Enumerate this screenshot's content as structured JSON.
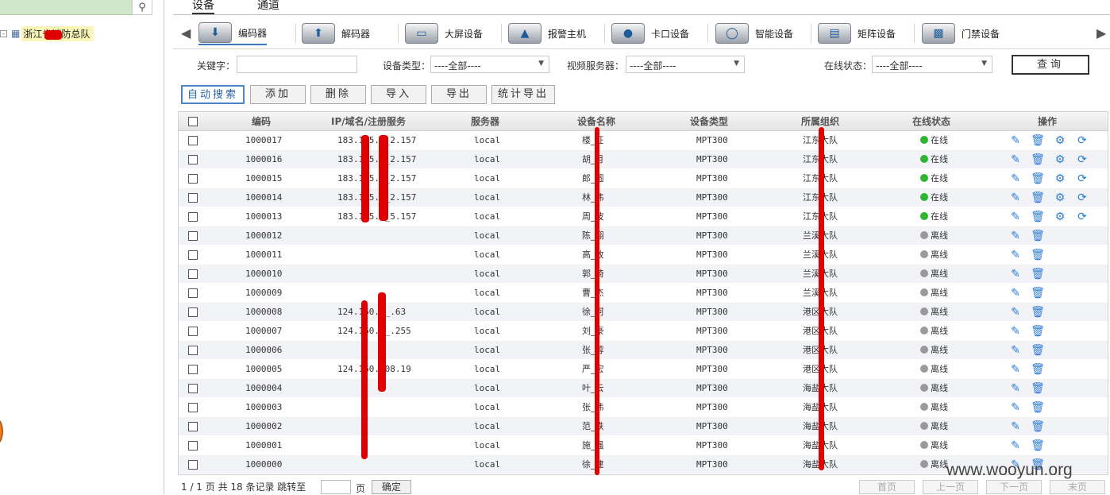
{
  "left": {
    "tree_root_label": "浙江省消防总队",
    "tree_toggle": "-"
  },
  "top_tabs": [
    "设备",
    "通道"
  ],
  "categories": [
    {
      "label": "编码器",
      "icon": "encoder-icon"
    },
    {
      "label": "解码器",
      "icon": "decoder-icon"
    },
    {
      "label": "大屏设备",
      "icon": "screen-icon"
    },
    {
      "label": "报警主机",
      "icon": "alarm-icon"
    },
    {
      "label": "卡口设备",
      "icon": "checkpoint-icon"
    },
    {
      "label": "智能设备",
      "icon": "smart-icon"
    },
    {
      "label": "矩阵设备",
      "icon": "matrix-icon"
    },
    {
      "label": "门禁设备",
      "icon": "lock-icon"
    }
  ],
  "filter": {
    "keyword_label": "关键字：",
    "type_label": "设备类型：",
    "type_value": "----全部----",
    "server_label": "视频服务器：",
    "server_value": "----全部----",
    "status_label": "在线状态：",
    "status_value": "----全部----",
    "query_label": "查询"
  },
  "toolbar": [
    "自动搜索",
    "添加",
    "删除",
    "导入",
    "导出",
    "统计导出"
  ],
  "columns": [
    "编码",
    "IP/域名/注册服务",
    "服务器",
    "设备名称",
    "设备类型",
    "所属组织",
    "在线状态",
    "操作"
  ],
  "rows": [
    {
      "code": "1000017",
      "ip": "183.1_5.1_2.157",
      "server": "local",
      "name": "楼_征",
      "type": "MPT300",
      "org": "江东大队",
      "status": "在线",
      "online": true
    },
    {
      "code": "1000016",
      "ip": "183.1_5.1_2.157",
      "server": "local",
      "name": "胡_月",
      "type": "MPT300",
      "org": "江东大队",
      "status": "在线",
      "online": true
    },
    {
      "code": "1000015",
      "ip": "183.1_5.1_2.157",
      "server": "local",
      "name": "郎_圆",
      "type": "MPT300",
      "org": "江东大队",
      "status": "在线",
      "online": true
    },
    {
      "code": "1000014",
      "ip": "183.1_5.1_2.157",
      "server": "local",
      "name": "林_伟",
      "type": "MPT300",
      "org": "江东大队",
      "status": "在线",
      "online": true
    },
    {
      "code": "1000013",
      "ip": "183.1_5.1_5.157",
      "server": "local",
      "name": "周_波",
      "type": "MPT300",
      "org": "江东大队",
      "status": "在线",
      "online": true
    },
    {
      "code": "1000012",
      "ip": "",
      "server": "local",
      "name": "陈_翔",
      "type": "MPT300",
      "org": "兰溪大队",
      "status": "离线",
      "online": false
    },
    {
      "code": "1000011",
      "ip": "",
      "server": "local",
      "name": "高_政",
      "type": "MPT300",
      "org": "兰溪大队",
      "status": "离线",
      "online": false
    },
    {
      "code": "1000010",
      "ip": "",
      "server": "local",
      "name": "郭_琦",
      "type": "MPT300",
      "org": "兰溪大队",
      "status": "离线",
      "online": false
    },
    {
      "code": "1000009",
      "ip": "",
      "server": "local",
      "name": "曹_杰",
      "type": "MPT300",
      "org": "兰溪大队",
      "status": "离线",
      "online": false
    },
    {
      "code": "1000008",
      "ip": "124.160.__.63",
      "server": "local",
      "name": "徐_珂",
      "type": "MPT300",
      "org": "港区大队",
      "status": "离线",
      "online": false
    },
    {
      "code": "1000007",
      "ip": "124.160.__.255",
      "server": "local",
      "name": "刘_豪",
      "type": "MPT300",
      "org": "港区大队",
      "status": "离线",
      "online": false
    },
    {
      "code": "1000006",
      "ip": "",
      "server": "local",
      "name": "张_蓉",
      "type": "MPT300",
      "org": "港区大队",
      "status": "离线",
      "online": false
    },
    {
      "code": "1000005",
      "ip": "124.160.208.19",
      "server": "local",
      "name": "严_宏",
      "type": "MPT300",
      "org": "港区大队",
      "status": "离线",
      "online": false
    },
    {
      "code": "1000004",
      "ip": "",
      "server": "local",
      "name": "叶_云",
      "type": "MPT300",
      "org": "海盐大队",
      "status": "离线",
      "online": false
    },
    {
      "code": "1000003",
      "ip": "",
      "server": "local",
      "name": "张_伟",
      "type": "MPT300",
      "org": "海盐大队",
      "status": "离线",
      "online": false
    },
    {
      "code": "1000002",
      "ip": "",
      "server": "local",
      "name": "范_轶",
      "type": "MPT300",
      "org": "海盐大队",
      "status": "离线",
      "online": false
    },
    {
      "code": "1000001",
      "ip": "",
      "server": "local",
      "name": "施_强",
      "type": "MPT300",
      "org": "海盐大队",
      "status": "离线",
      "online": false
    },
    {
      "code": "1000000",
      "ip": "",
      "server": "local",
      "name": "徐_建",
      "type": "MPT300",
      "org": "海盐大队",
      "status": "离线",
      "online": false
    }
  ],
  "pager": {
    "info": "1 / 1 页 共 18 条记录 跳转至",
    "page_unit": "页",
    "ok_label": "确定",
    "first": "首页",
    "prev": "上一页",
    "next": "下一页",
    "last": "末页"
  },
  "watermark": "www.wooyun.org",
  "colors": {
    "online": "#2fb52f",
    "offline": "#9a9a9a",
    "accent": "#2e7cd6"
  }
}
